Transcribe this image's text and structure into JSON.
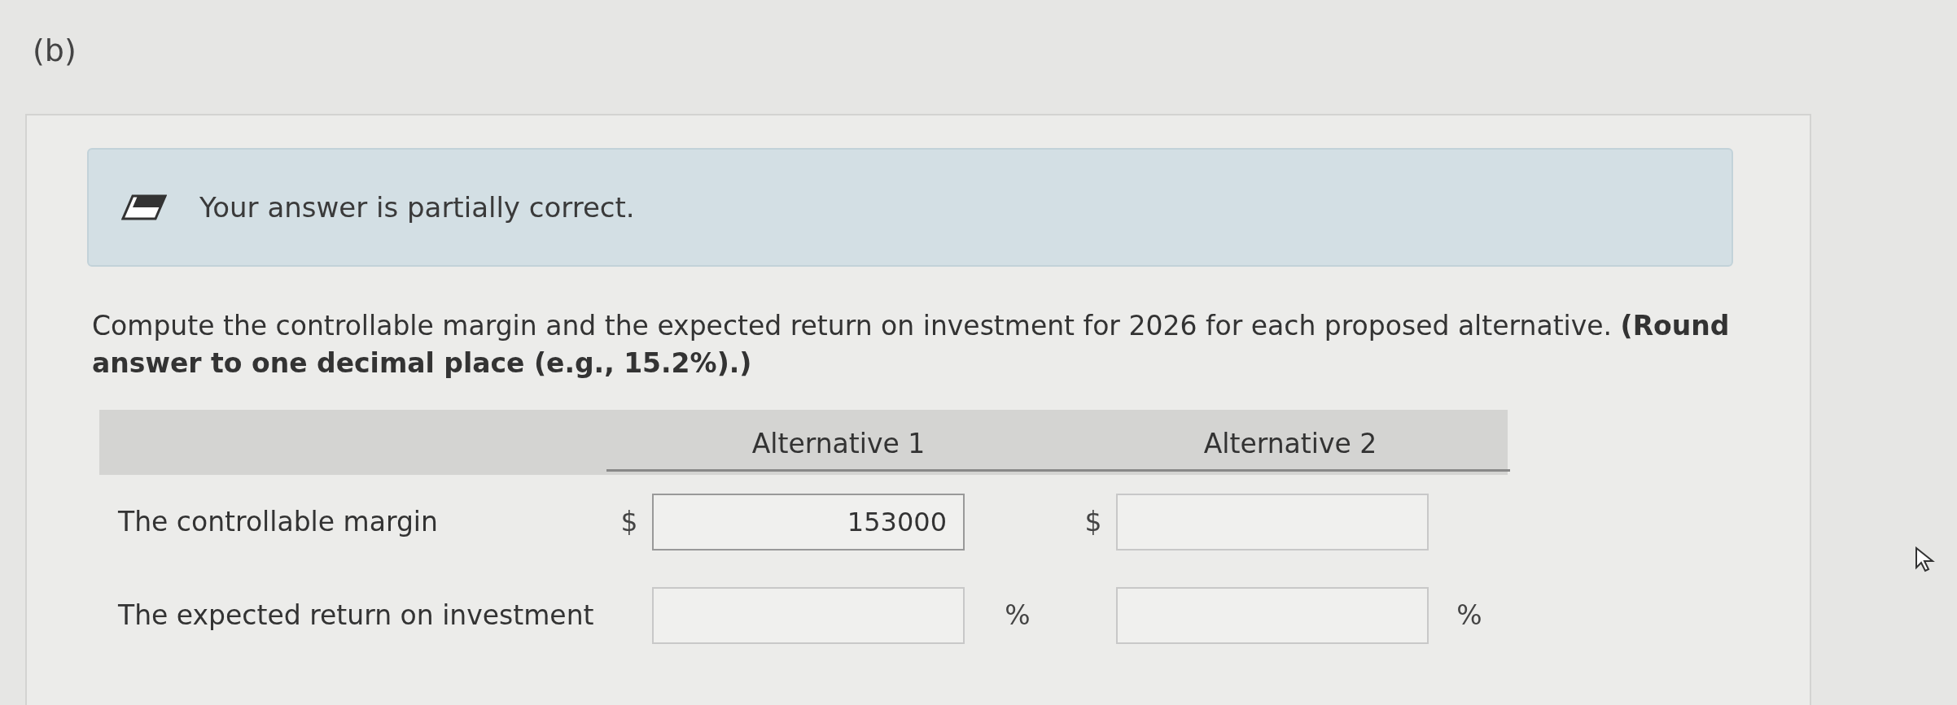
{
  "part_label": "(b)",
  "feedback": {
    "message": "Your answer is partially correct."
  },
  "question": {
    "text": "Compute the controllable margin and the expected return on investment for 2026 for each proposed alternative. **(Round answer to one decimal place (e.g., 15.2%).)**"
  },
  "table": {
    "columns": [
      "Alternative 1",
      "Alternative 2"
    ],
    "rows": [
      {
        "label": "The controllable margin",
        "cells": [
          {
            "prefix": "$",
            "value": "153000"
          },
          {
            "prefix": "$"
          }
        ]
      },
      {
        "label": "The expected return on investment",
        "cells": [
          {
            "suffix": "%"
          },
          {
            "suffix": "%"
          }
        ]
      }
    ]
  }
}
